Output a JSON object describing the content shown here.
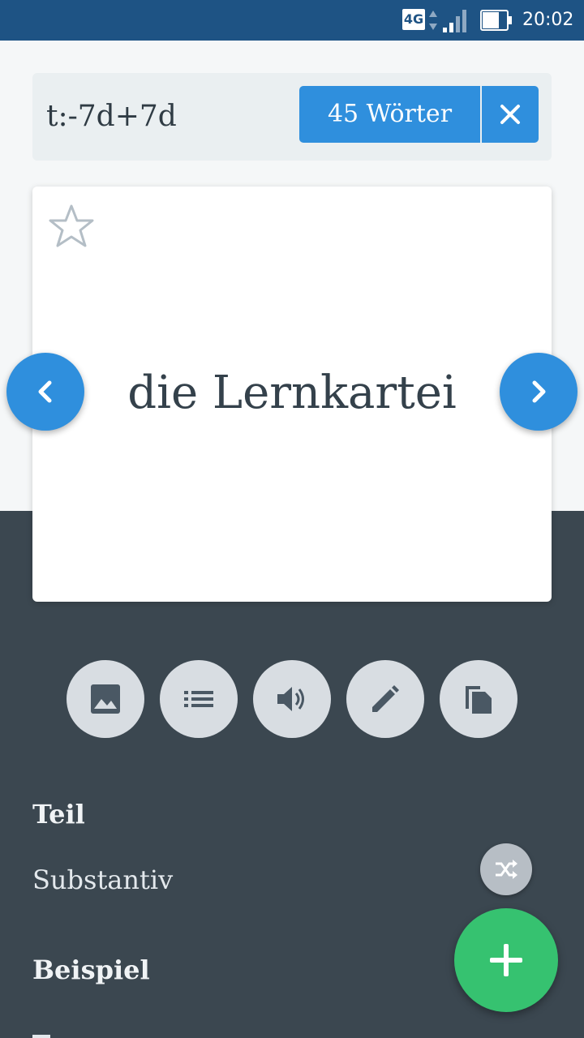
{
  "status_bar": {
    "network": "4G",
    "time": "20:02"
  },
  "search": {
    "query": "t:-7d+7d",
    "count_label": "45 Wörter"
  },
  "card": {
    "word": "die Lernkartei",
    "starred": false
  },
  "toolbar": {
    "buttons": [
      "image-icon",
      "list-icon",
      "speaker-icon",
      "pencil-icon",
      "copy-icon"
    ]
  },
  "details": [
    {
      "label": "Teil",
      "value": "Substantiv"
    },
    {
      "label": "Beispiel",
      "value": ""
    }
  ],
  "colors": {
    "status_bar": "#1e5384",
    "accent": "#2f8fdd",
    "dark_panel": "#3b4750",
    "fab": "#36c270"
  }
}
